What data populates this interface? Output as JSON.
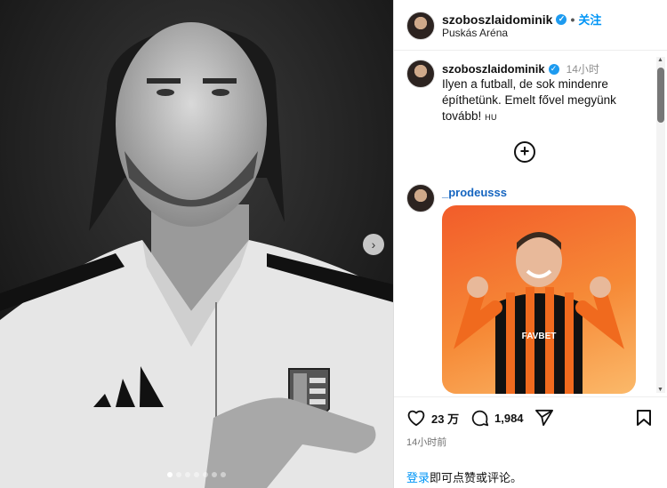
{
  "post": {
    "media": {
      "next_arrow": "›",
      "carousel_dots": 7,
      "active_dot": 0
    },
    "header": {
      "username": "szoboszlaidominik",
      "verified_glyph": "✓",
      "separator": "•",
      "follow_label": "关注",
      "location": "Puskás Aréna"
    },
    "caption": {
      "username": "szoboszlaidominik",
      "verified_glyph": "✓",
      "time": "14小时",
      "text": "Ilyen a futball, de sok mindenre építhetünk. Emelt fővel megyünk tovább!",
      "lang_tag": "HU"
    },
    "load_more_glyph": "+",
    "comment": {
      "username": "_prodeusss",
      "sticker_shirt_text": "FAVBET"
    },
    "actions": {
      "like_count": "23 万",
      "comment_count": "1,984",
      "time_ago": "14小时前"
    },
    "footer": {
      "login_link": "登录",
      "login_suffix": "即可点赞或评论。"
    },
    "colors": {
      "accent": "#0095f6",
      "verified": "#1d9bf0",
      "sticker_orange": "#f25c2a"
    }
  }
}
